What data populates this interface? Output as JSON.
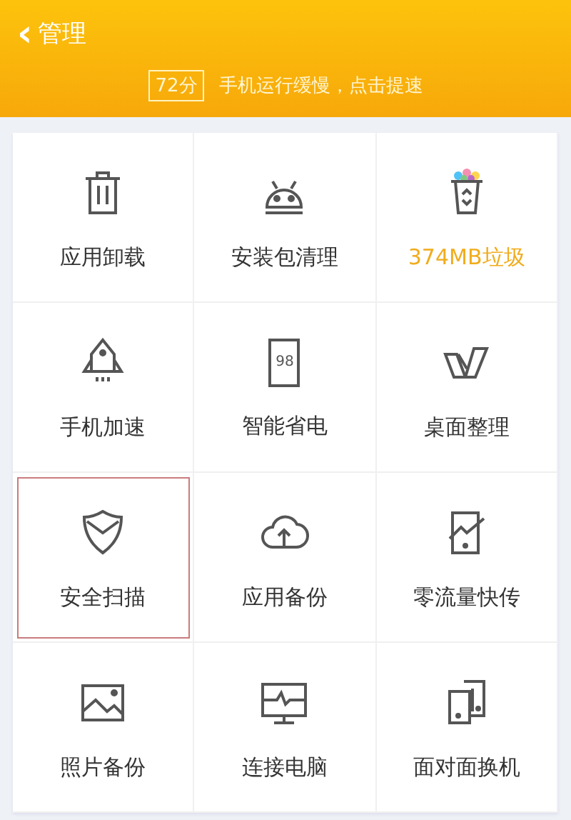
{
  "header": {
    "back": "‹",
    "title": "管理",
    "score": "72分",
    "message": "手机运行缓慢，点击提速"
  },
  "battery_icon_reading": "98",
  "tiles": [
    {
      "label": "应用卸载",
      "selected": false,
      "highlighted": false
    },
    {
      "label": "安装包清理",
      "selected": false,
      "highlighted": false
    },
    {
      "label": "374MB垃圾",
      "selected": false,
      "highlighted": true
    },
    {
      "label": "手机加速",
      "selected": false,
      "highlighted": false
    },
    {
      "label": "智能省电",
      "selected": false,
      "highlighted": false
    },
    {
      "label": "桌面整理",
      "selected": false,
      "highlighted": false
    },
    {
      "label": "安全扫描",
      "selected": true,
      "highlighted": false
    },
    {
      "label": "应用备份",
      "selected": false,
      "highlighted": false
    },
    {
      "label": "零流量快传",
      "selected": false,
      "highlighted": false
    },
    {
      "label": "照片备份",
      "selected": false,
      "highlighted": false
    },
    {
      "label": "连接电脑",
      "selected": false,
      "highlighted": false
    },
    {
      "label": "面对面换机",
      "selected": false,
      "highlighted": false
    }
  ]
}
